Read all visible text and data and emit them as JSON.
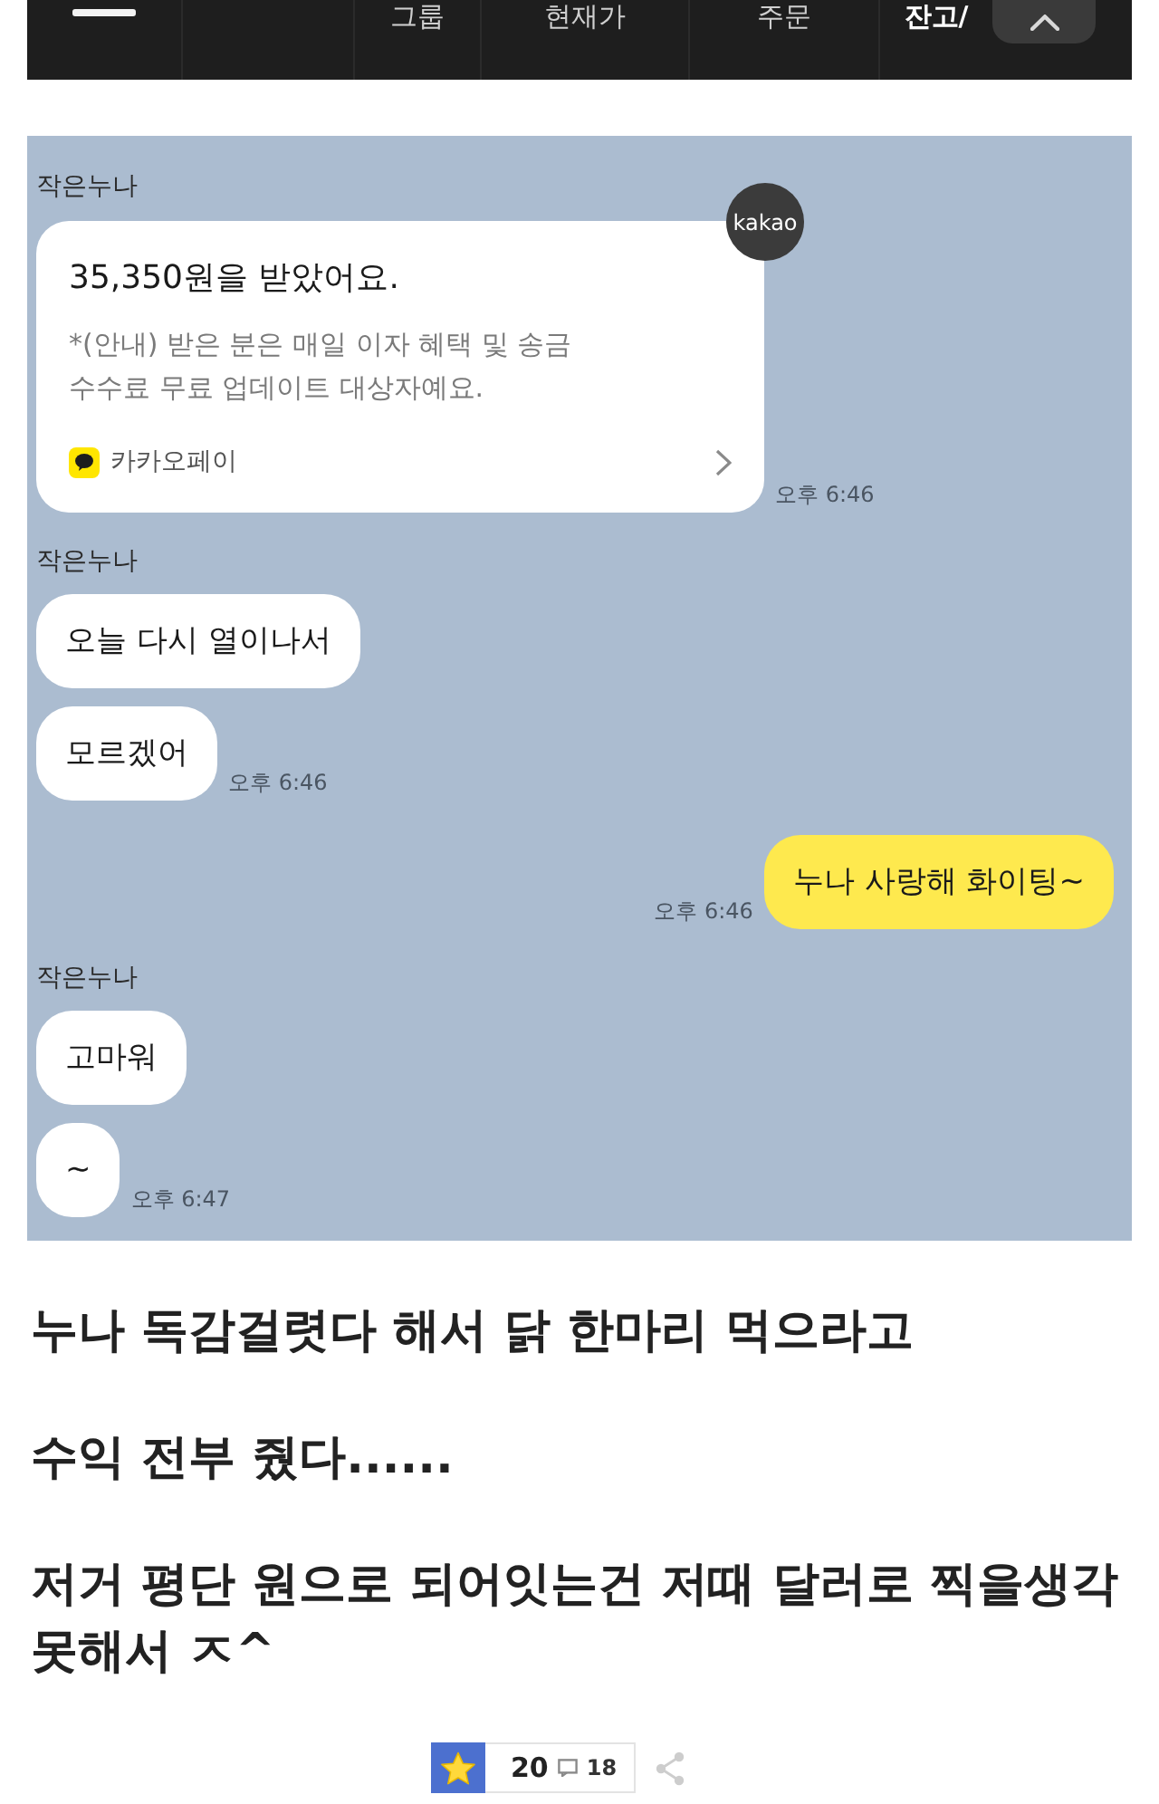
{
  "top_nav": {
    "tabs": [
      {
        "label": "그룹",
        "selected": false
      },
      {
        "label": "현재가",
        "selected": false
      },
      {
        "label": "주문",
        "selected": false
      },
      {
        "label": "잔고/",
        "selected": true
      }
    ]
  },
  "chat": {
    "groups": [
      {
        "kind": "received",
        "sender": "작은누나",
        "messages": [
          {
            "kind": "payment",
            "title": "35,350원을 받았어요.",
            "note_lines": [
              "*(안내) 받은 분은 매일 이자 혜택 및 송금",
              "수수료 무료 업데이트 대상자예요."
            ],
            "service": "카카오페이",
            "badge": "kakao",
            "time": "오후 6:46"
          }
        ]
      },
      {
        "kind": "received",
        "sender": "작은누나",
        "messages": [
          {
            "kind": "text",
            "text": "오늘 다시 열이나서"
          },
          {
            "kind": "text",
            "text": "모르겠어",
            "time": "오후 6:46"
          }
        ]
      },
      {
        "kind": "sent",
        "messages": [
          {
            "kind": "text",
            "text": "누나 사랑해 화이팅~",
            "time": "오후 6:46"
          }
        ]
      },
      {
        "kind": "received",
        "sender": "작은누나",
        "messages": [
          {
            "kind": "text",
            "text": "고마워"
          },
          {
            "kind": "text",
            "text": "~",
            "time": "오후 6:47"
          }
        ]
      }
    ]
  },
  "post": {
    "paragraphs": [
      "누나 독감걸렷다 해서 닭 한마리 먹으라고",
      "수익 전부 줬다......",
      "저거 평단 원으로 되어잇는건 저때 달러로 찍을생각 못해서 ㅈ^"
    ]
  },
  "footer": {
    "recommend_count": "20",
    "comment_count": "18"
  }
}
